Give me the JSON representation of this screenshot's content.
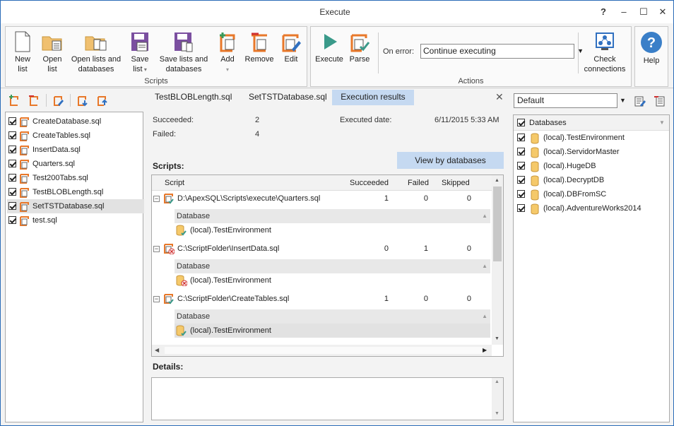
{
  "window": {
    "title": "Execute",
    "help": "?",
    "minimize": "–",
    "maximize": "☐",
    "close": "✕"
  },
  "ribbon": {
    "scripts_group": "Scripts",
    "actions_group": "Actions",
    "help_group_label": "",
    "new_list": [
      "New",
      "list"
    ],
    "open_list": [
      "Open",
      "list"
    ],
    "open_lists_db": [
      "Open lists and",
      "databases"
    ],
    "save_list": [
      "Save",
      "list"
    ],
    "save_lists_db": [
      "Save lists and",
      "databases"
    ],
    "add": "Add",
    "remove": "Remove",
    "edit": "Edit",
    "execute": "Execute",
    "parse": "Parse",
    "on_error_label": "On error:",
    "on_error_value": "Continue executing",
    "check_connections": [
      "Check",
      "connections"
    ],
    "help": "Help"
  },
  "script_list": [
    {
      "name": "CreateDatabase.sql",
      "checked": true
    },
    {
      "name": "CreateTables.sql",
      "checked": true
    },
    {
      "name": "InsertData.sql",
      "checked": true
    },
    {
      "name": "Quarters.sql",
      "checked": true
    },
    {
      "name": "Test200Tabs.sql",
      "checked": true
    },
    {
      "name": "TestBLOBLength.sql",
      "checked": true
    },
    {
      "name": "SetTSTDatabase.sql",
      "checked": true,
      "selected": true
    },
    {
      "name": "test.sql",
      "checked": true
    }
  ],
  "tabs": [
    {
      "label": "TestBLOBLength.sql"
    },
    {
      "label": "SetTSTDatabase.sql"
    },
    {
      "label": "Execution results",
      "active": true
    }
  ],
  "summary": {
    "succeeded_label": "Succeeded:",
    "succeeded_value": "2",
    "failed_label": "Failed:",
    "failed_value": "4",
    "executed_label": "Executed date:",
    "executed_value": "6/11/2015 5:33 AM"
  },
  "view_by_databases": "View by databases",
  "scripts_heading": "Scripts:",
  "grid": {
    "columns": [
      "Script",
      "Succeeded",
      "Failed",
      "Skipped"
    ],
    "db_column": "Database",
    "rows": [
      {
        "path": "D:\\ApexSQL\\Scripts\\execute\\Quarters.sql",
        "succeeded": "1",
        "failed": "0",
        "skipped": "0",
        "status": "ok",
        "db": "(local).TestEnvironment",
        "db_status": "ok"
      },
      {
        "path": "C:\\ScriptFolder\\InsertData.sql",
        "succeeded": "0",
        "failed": "1",
        "skipped": "0",
        "status": "error",
        "db": "(local).TestEnvironment",
        "db_status": "error"
      },
      {
        "path": "C:\\ScriptFolder\\CreateTables.sql",
        "succeeded": "1",
        "failed": "0",
        "skipped": "0",
        "status": "ok",
        "db": "(local).TestEnvironment",
        "db_status": "ok"
      }
    ]
  },
  "details_heading": "Details:",
  "databases": {
    "profile": "Default",
    "header": "Databases",
    "items": [
      "(local).TestEnvironment",
      "(local).ServidorMaster",
      "(local).HugeDB",
      "(local).DecryptDB",
      "(local).DBFromSC",
      "(local).AdventureWorks2014"
    ]
  },
  "colors": {
    "accent": "#e8782a",
    "selection": "#c5d9f1",
    "execute": "#3a9a8a",
    "purple": "#7b4fa0"
  }
}
